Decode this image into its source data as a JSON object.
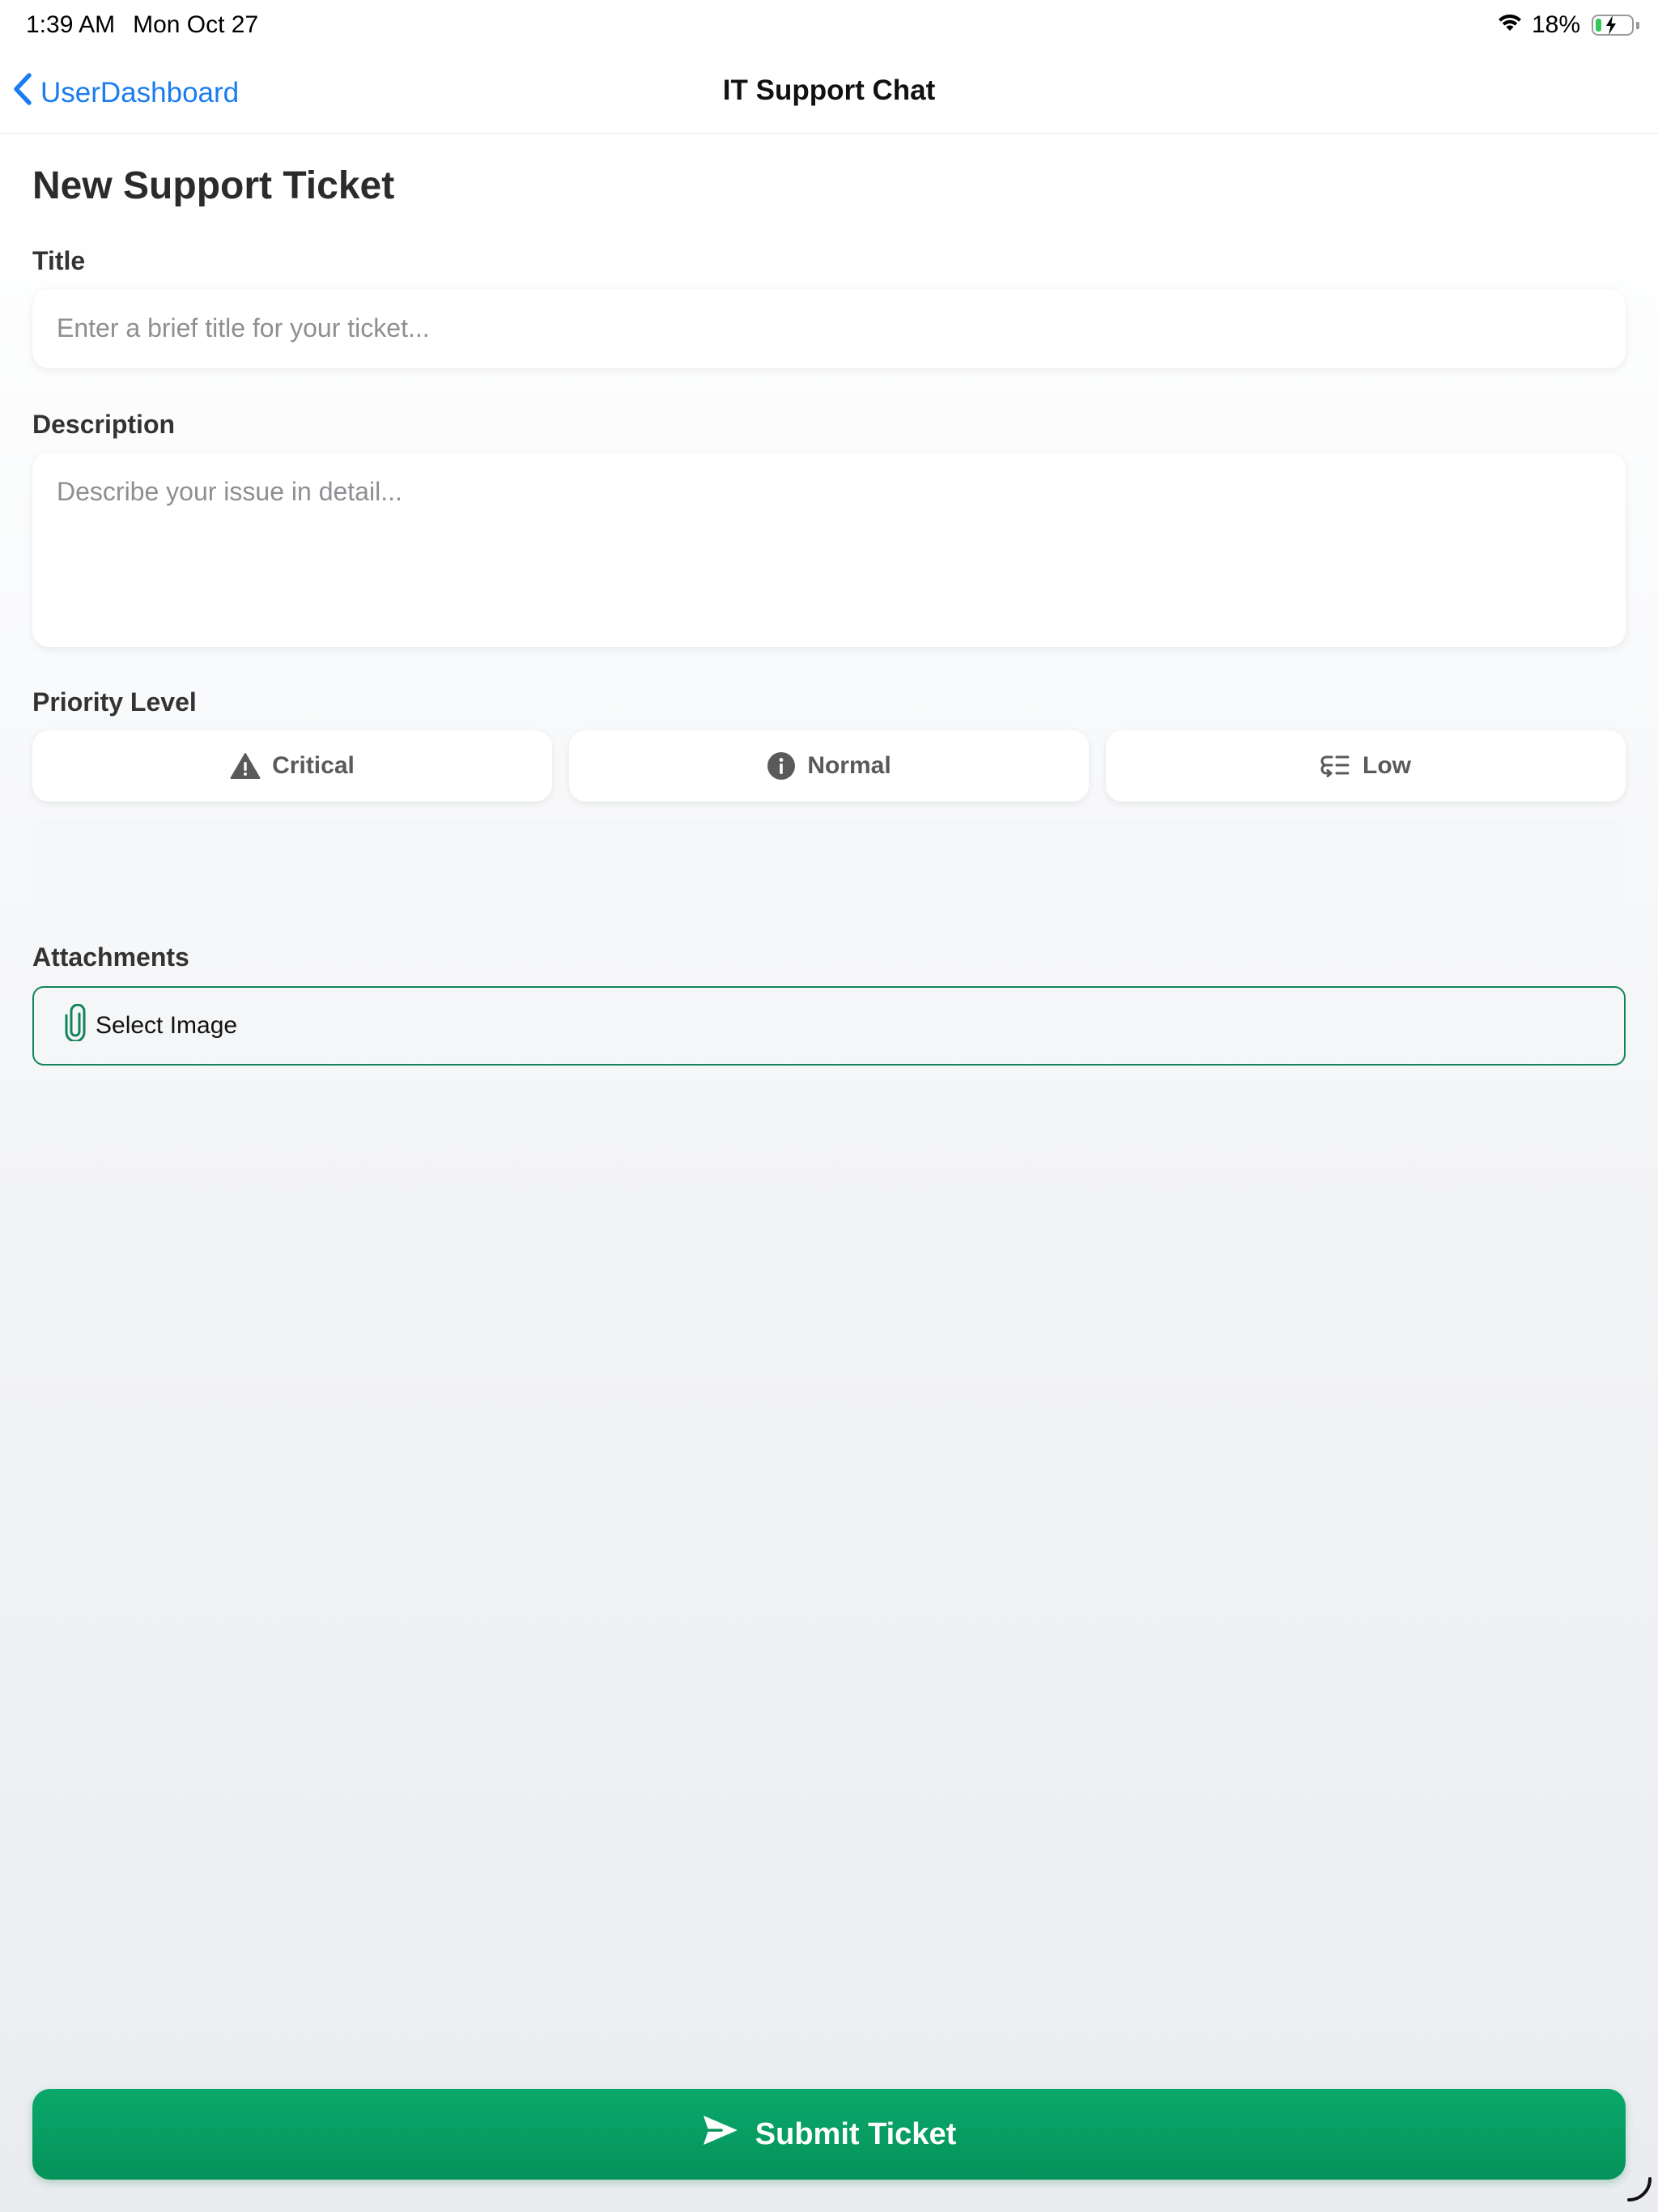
{
  "status_bar": {
    "time": "1:39 AM",
    "date": "Mon Oct 27",
    "battery_percent": "18%",
    "battery_level": 0.18,
    "icons": [
      "wifi-icon",
      "battery-charging-icon"
    ]
  },
  "nav": {
    "back_label": "UserDashboard",
    "title": "IT Support Chat"
  },
  "form": {
    "heading": "New Support Ticket",
    "title_label": "Title",
    "title_placeholder": "Enter a brief title for your ticket...",
    "title_value": "",
    "description_label": "Description",
    "description_placeholder": "Describe your issue in detail...",
    "description_value": "",
    "priority_label": "Priority Level",
    "priorities": [
      {
        "label": "Critical",
        "icon": "warning-triangle-icon"
      },
      {
        "label": "Normal",
        "icon": "info-circle-icon"
      },
      {
        "label": "Low",
        "icon": "low-priority-list-icon"
      }
    ],
    "attachments_label": "Attachments",
    "select_image_label": "Select Image",
    "submit_label": "Submit Ticket"
  },
  "colors": {
    "accent_blue": "#1a7cf0",
    "accent_green": "#05935a",
    "attach_border": "#12845a",
    "label_text": "#333333",
    "placeholder": "#8e8e93"
  }
}
